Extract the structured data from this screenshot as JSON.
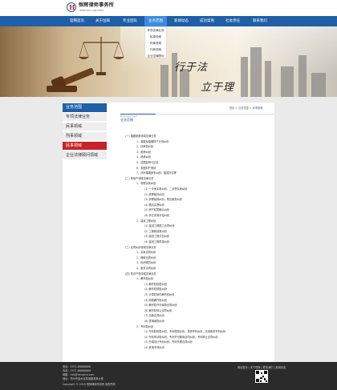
{
  "brand": {
    "logo_letter": "H",
    "name": "恒辉律师事务所",
    "subtitle": "HENGHUI LAW FIRM"
  },
  "nav": {
    "items": [
      {
        "label": "官网首页"
      },
      {
        "label": "关于恒辉"
      },
      {
        "label": "专业团队"
      },
      {
        "label": "业务范围",
        "active": true
      },
      {
        "label": "新闻动态"
      },
      {
        "label": "成功案例"
      },
      {
        "label": "社会责任"
      },
      {
        "label": "联系我们"
      }
    ],
    "dropdown": [
      "专项法律业务",
      "民事领域",
      "刑事领域",
      "行政领域",
      "企业法律顾问"
    ]
  },
  "banner": {
    "line1": "行于法",
    "line2": "立于理"
  },
  "sidebar": {
    "title": "业务范围",
    "items": [
      {
        "label": "专项法律业务"
      },
      {
        "label": "民事领域"
      },
      {
        "label": "刑事领域"
      },
      {
        "label": "民事领域",
        "active": true
      },
      {
        "label": "企业法律顾问领域"
      }
    ]
  },
  "breadcrumb": {
    "home": "首页",
    "sep1": ">",
    "section": "业务范围",
    "sep2": ">",
    "current": "民事领域"
  },
  "panel": {
    "title_en": "Business Field",
    "title_cn": "业务范围"
  },
  "body_lines": [
    "(一) 婚姻家庭领域法律业务",
    "1、离婚及婚姻财产分割纠纷",
    "2、抚养权纠纷",
    "3、赡养纠纷",
    "4、继承纠纷",
    "5、遗嘱起草与见证",
    "6、家庭财产规划",
    "7、涉外婚姻家事纠纷，婚前协议等",
    "(二) 房地产领域法律业务",
    "1、房屋买卖纠纷",
    "(1) 一手房买卖纠纷，二手房买卖纠纷",
    "(2) 房屋租赁纠纷",
    "(3) 房屋装修纠纷，物业服务纠纷",
    "(4) 借名买房纠纷",
    "(5) 房产权属确认纠纷",
    "(6) 拆迁安置补偿纠纷",
    "2、建设工程纠纷",
    "(1) 建设工程施工合同纠纷",
    "(2) 工程款结算纠纷",
    "(3) 建设工程分包纠纷",
    "(4) 建设工程质量纠纷",
    "(三) 合同纠纷领域法律业务",
    "1、买卖合同纠纷",
    "2、借款合同纠纷",
    "3、民间借贷纠纷",
    "4、租赁合同纠纷",
    "(四) 知识产权领域法律业务",
    "1、著作权纠纷",
    "(1) 著作权权属纠纷",
    "(2) 著作权侵权纠纷",
    "(3) 计算机软件著作权纠纷",
    "(4) 网络著作权纠纷",
    "(5) 著作权许可使用合同纠纷",
    "(6) 著作权转让合同纠纷",
    "(7) 出版合同纠纷",
    "(8) 表演者权纠纷",
    "2、专利权纠纷",
    "(1) 专利权权属纠纷，专利侵权纠纷，发明专利纠纷，实用新型专利纠纷",
    "(2) 专利申请权纠纷，专利许可使用合同纠纷，专利转让合同纠纷",
    "(3) 外观设计专利纠纷，专利代理合同纠纷",
    "(4) 其他专利纠纷"
  ],
  "footer": {
    "lines": [
      "电话：0371-88888888",
      "传真：0371-88888888",
      "邮箱：info@henghui.com",
      "地址：郑州市金水区某某路某某大厦",
      "Copyright © 2019 恒辉律师事务所 版权所有"
    ],
    "links": "网站首页 | 关于恒辉 | 联系我们 | 新闻动态"
  }
}
